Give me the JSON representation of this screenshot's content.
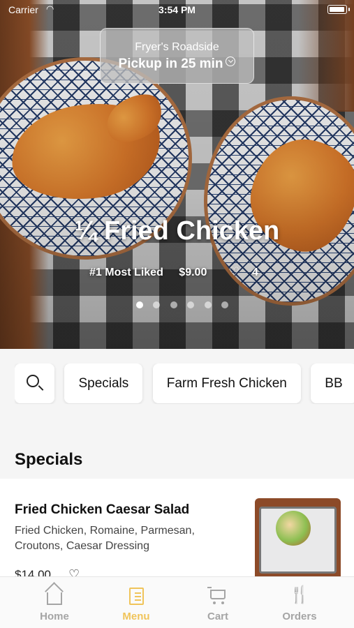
{
  "status_bar": {
    "carrier": "Carrier",
    "time": "3:54 PM"
  },
  "pickup": {
    "store": "Fryer's Roadside",
    "eta": "Pickup in 25 min"
  },
  "hero": {
    "title": "¼ Fried Chicken",
    "badge": "#1 Most Liked",
    "price": "$9.00",
    "likes": "4",
    "carousel_total": 6,
    "carousel_active": 1
  },
  "categories": [
    "Specials",
    "Farm Fresh Chicken",
    "BB"
  ],
  "section": {
    "title": "Specials"
  },
  "item": {
    "name": "Fried Chicken Caesar Salad",
    "description": "Fried Chicken, Romaine, Parmesan, Croutons, Caesar Dressing",
    "price": "$14.00"
  },
  "tabs": {
    "home": "Home",
    "menu": "Menu",
    "cart": "Cart",
    "orders": "Orders",
    "active": "menu"
  },
  "colors": {
    "accent": "#f0c45a",
    "tab_inactive": "#a5a5a5"
  },
  "icons": {
    "heart": "heart-icon",
    "search": "search-icon",
    "home": "home-icon",
    "menu": "menu-book-icon",
    "cart": "cart-icon",
    "orders": "fork-knife-icon"
  }
}
